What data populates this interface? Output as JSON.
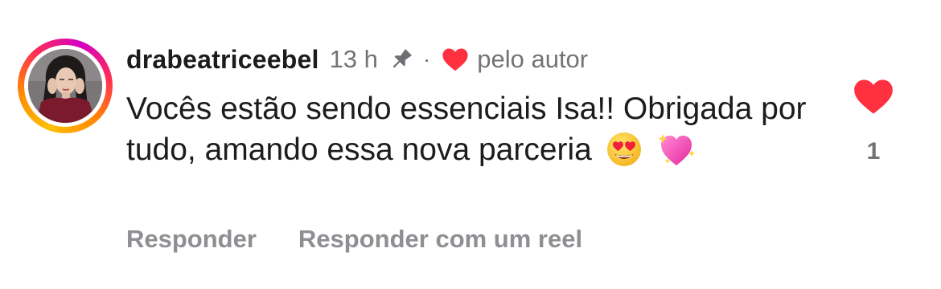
{
  "comment": {
    "username": "drabeatriceebel",
    "time": "13 h",
    "separator": "·",
    "liked_by_author_label": "pelo autor",
    "text": "Vocês estão sendo essenciais Isa!! Obrigada por tudo, amando essa nova parceria",
    "emojis": [
      "heart-eyes-emoji",
      "sparkling-heart-emoji"
    ],
    "like_count": "1"
  },
  "actions": {
    "reply": "Responder",
    "reply_with_reel": "Responder com um reel"
  },
  "colors": {
    "heart_red": "#ff3040",
    "text_primary": "#1c1c1e",
    "text_secondary": "#737373",
    "action_gray": "#8e8e93"
  },
  "icons": {
    "pin": "pin-icon",
    "author_heart": "heart-icon",
    "like": "heart-icon"
  }
}
